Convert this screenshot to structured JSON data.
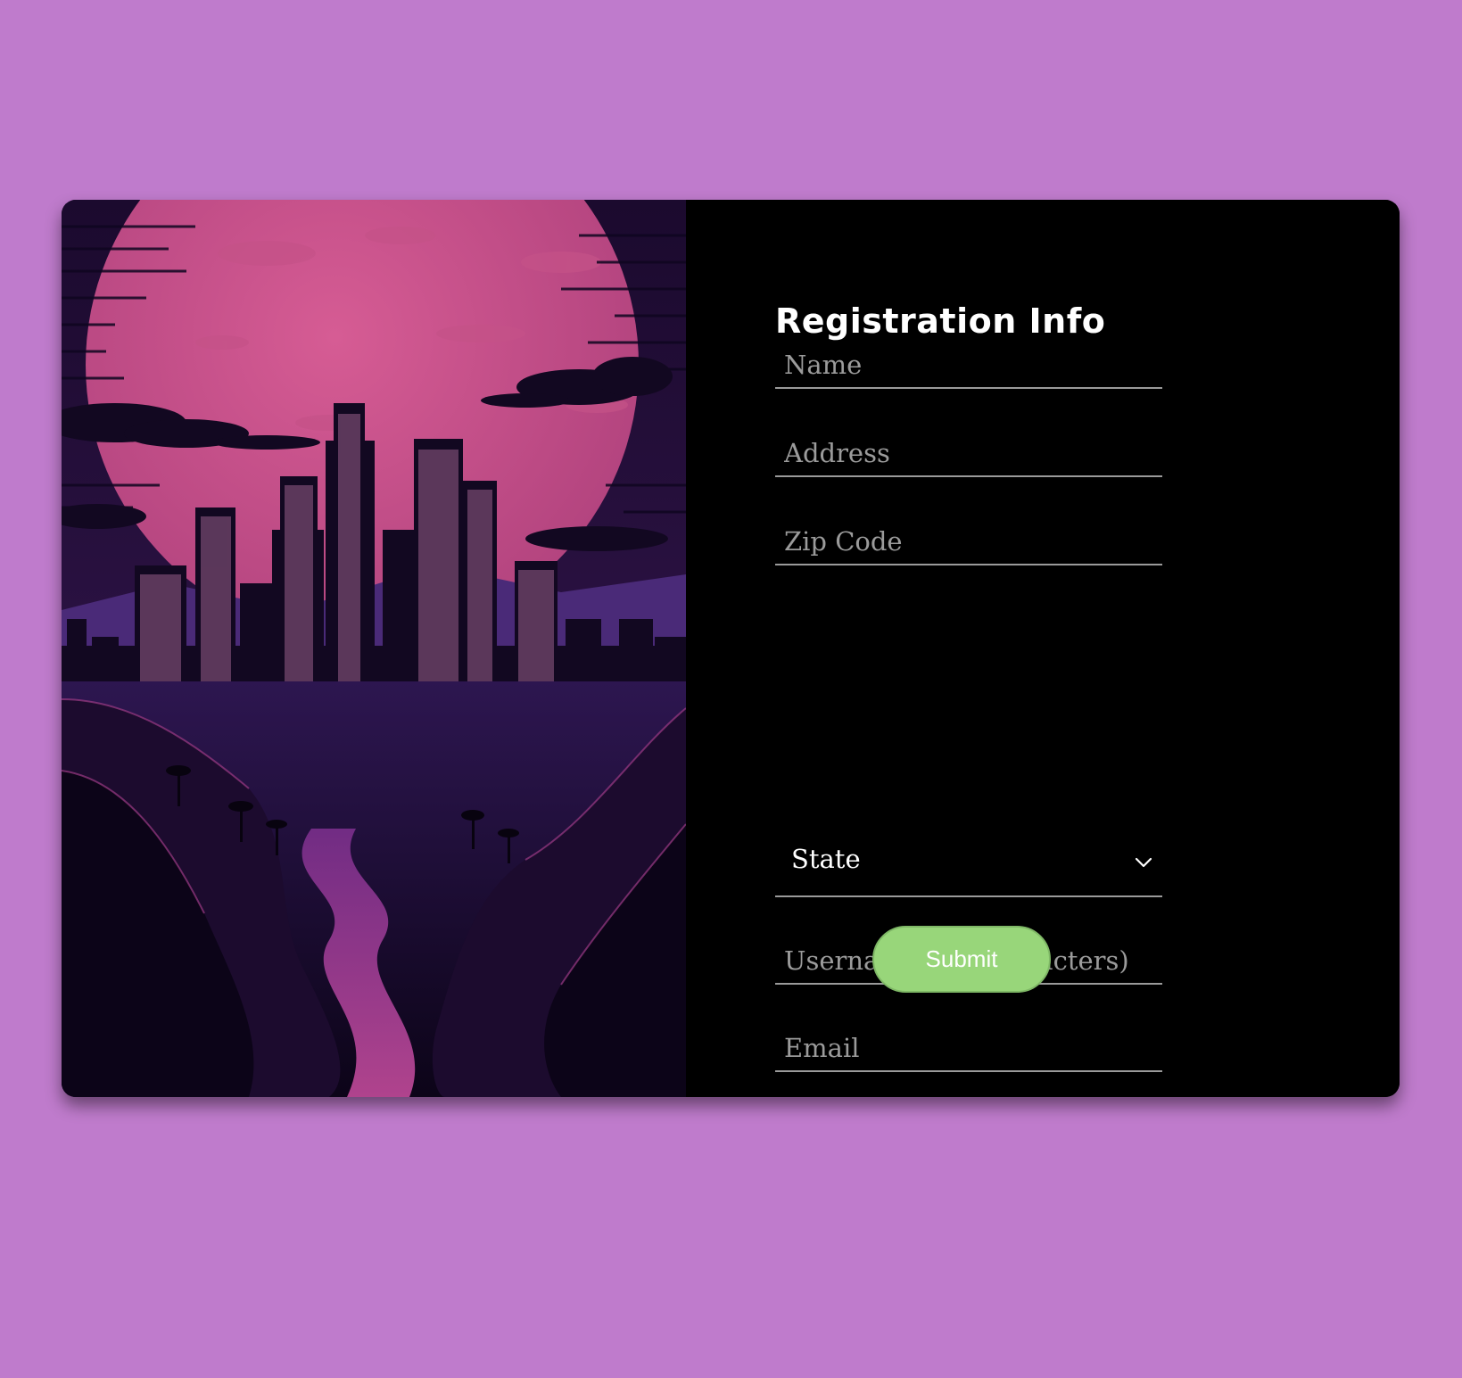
{
  "form": {
    "title": "Registration Info",
    "fields": {
      "name": {
        "placeholder": "Name",
        "value": ""
      },
      "address": {
        "placeholder": "Address",
        "value": ""
      },
      "zip": {
        "placeholder": "Zip Code",
        "value": ""
      },
      "state": {
        "selected": "State"
      },
      "username": {
        "placeholder": "Username(6-8 characters)",
        "value": ""
      },
      "email": {
        "placeholder": "Email",
        "value": ""
      }
    },
    "submit_label": "Submit"
  },
  "colors": {
    "page_background": "#bf7bcc",
    "panel_background": "#000000",
    "submit_button": "#98d67a",
    "field_underline": "#9a9a9a",
    "placeholder_text": "#9b9b9b"
  },
  "icons": {
    "state_dropdown": "chevron-down-icon"
  }
}
